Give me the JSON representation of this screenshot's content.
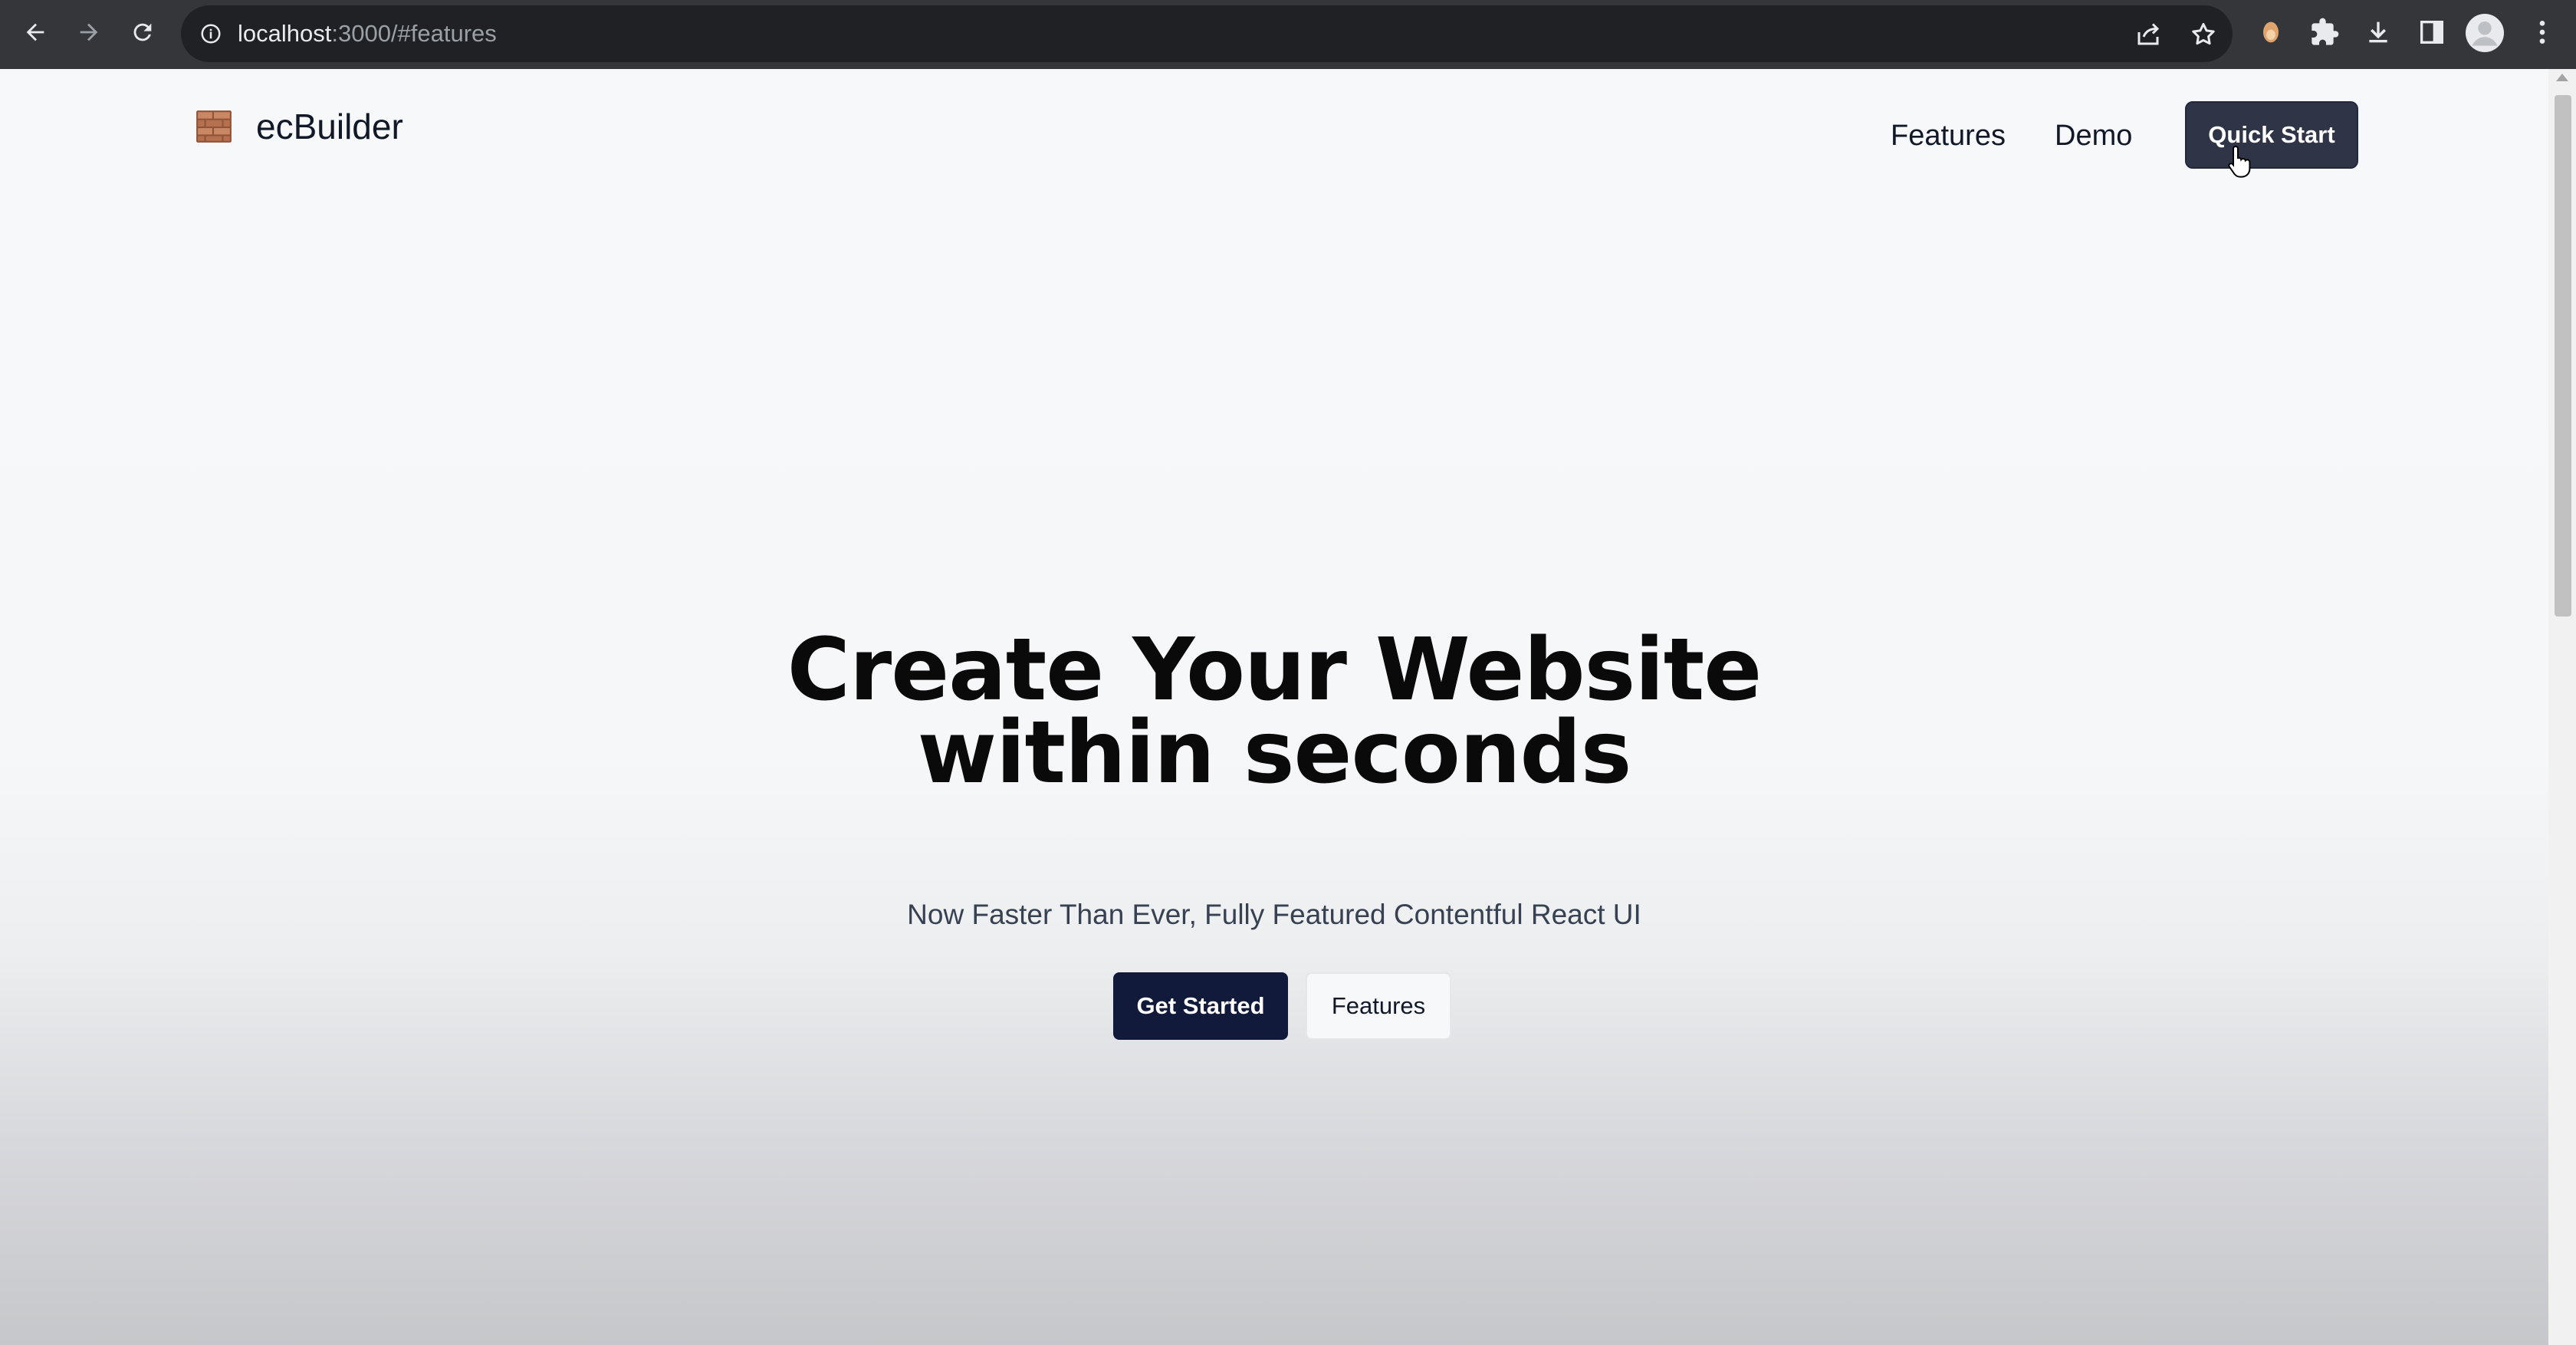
{
  "browser": {
    "url_host": "localhost",
    "url_rest": ":3000/#features",
    "icons": [
      "back-icon",
      "forward-icon",
      "reload-icon",
      "info-icon",
      "share-icon",
      "bookmark-star-icon",
      "extension-icon",
      "puzzle-icon",
      "download-icon",
      "side-panel-icon",
      "profile-avatar",
      "menu-kebab-icon"
    ]
  },
  "header": {
    "brand": "ecBuilder",
    "brand_icon": "brick-wall-icon",
    "nav": {
      "features": "Features",
      "demo": "Demo"
    },
    "cta": "Quick Start"
  },
  "hero": {
    "title_line1": "Create Your Website",
    "title_line2": "within seconds",
    "subtitle": "Now Faster Than Ever, Fully Featured Contentful React UI",
    "primary_button": "Get Started",
    "secondary_button": "Features"
  },
  "colors": {
    "chrome": "#35363a",
    "omnibox": "#202124",
    "quick_start_bg": "#2f3547",
    "get_started_bg": "#111a3a",
    "brick": "#b5714f"
  }
}
